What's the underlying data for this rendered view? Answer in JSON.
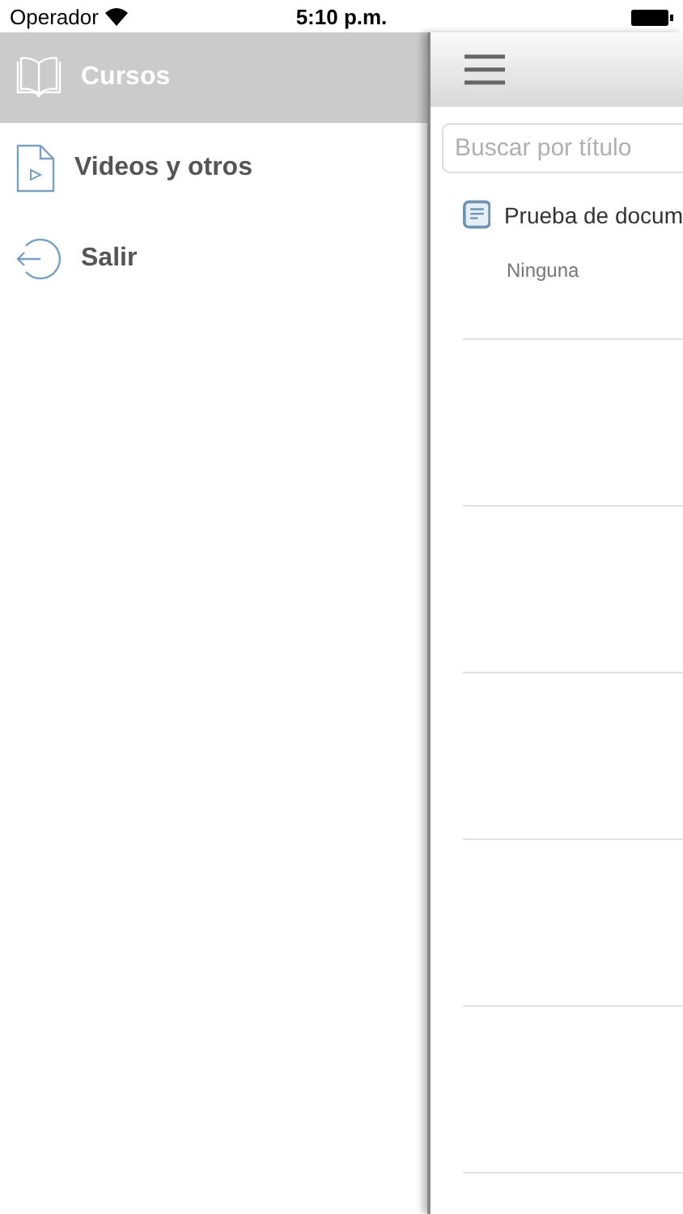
{
  "status_bar": {
    "carrier": "Operador",
    "time": "5:10 p.m."
  },
  "menu": {
    "items": [
      {
        "label": "Cursos",
        "kind": "book",
        "selected": true
      },
      {
        "label": "Videos y otros",
        "kind": "video",
        "selected": false
      },
      {
        "label": "Salir",
        "kind": "exit",
        "selected": false
      }
    ]
  },
  "panel": {
    "search": {
      "placeholder": "Buscar por título"
    },
    "documents": [
      {
        "title": "Prueba de docum",
        "subtitle": "Ninguna"
      }
    ]
  }
}
